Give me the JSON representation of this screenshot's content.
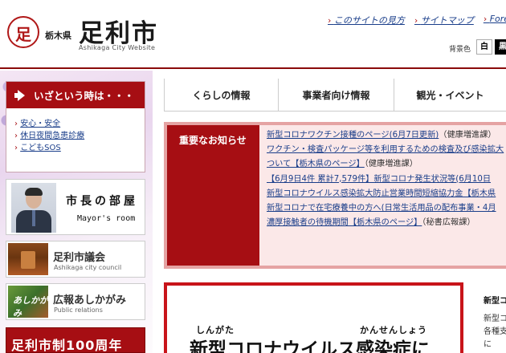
{
  "header": {
    "logo_glyph": "足",
    "prefecture": "栃木県",
    "city_name": "足利市",
    "city_name_en": "Ashikaga City Website",
    "links": [
      "このサイトの見方",
      "サイトマップ",
      "Foreign"
    ],
    "bg_color_label": "背景色",
    "bg_white": "白",
    "bg_black": "黒"
  },
  "emergency": {
    "title": "いざという時は・・・",
    "links": [
      "安心・安全",
      "休日夜間急患診療",
      "こどもSOS"
    ]
  },
  "mayor": {
    "title": "市長の部屋",
    "subtitle": "Mayor's room"
  },
  "council": {
    "title": "足利市議会",
    "subtitle": "Ashikaga city council"
  },
  "pr": {
    "title": "広報あしかがみ",
    "subtitle": "Public relations",
    "thumb_text": "あしかがみ"
  },
  "anniversary": {
    "text": "足利市制100周年"
  },
  "nav": {
    "items": [
      "くらしの情報",
      "事業者向け情報",
      "観光・イベント"
    ]
  },
  "notices": {
    "label": "重要なお知らせ",
    "items": [
      {
        "title": "新型コロナワクチン接種のページ(6月7日更新)",
        "tag": "（健康増進課）"
      },
      {
        "title": "ワクチン・検査パッケージ等を利用するための検査及び感染拡大",
        "tag": ""
      },
      {
        "title": "ついて【栃木県のページ】",
        "tag": "（健康増進課）"
      },
      {
        "title": "【6月9日4件 累計7,579件】新型コロナ発生状況等(6月10日",
        "tag": ""
      },
      {
        "title": "新型コロナウイルス感染拡大防止営業時間短縮協力金【栃木県",
        "tag": ""
      },
      {
        "title": "新型コロナで在宅療養中の方へ(日常生活用品の配布事業・4月",
        "tag": ""
      },
      {
        "title": "濃厚接触者の待機期間【栃木県のページ】",
        "tag": "（秘書広報課）"
      }
    ]
  },
  "banner": {
    "ruby_1": "しんがた",
    "ruby_2": "かんせんしょう",
    "main": "新型コロナウイルス感染症に"
  },
  "side_box": {
    "heading": "新型コ",
    "lines": [
      "新型コ",
      "各種支",
      "に"
    ]
  }
}
